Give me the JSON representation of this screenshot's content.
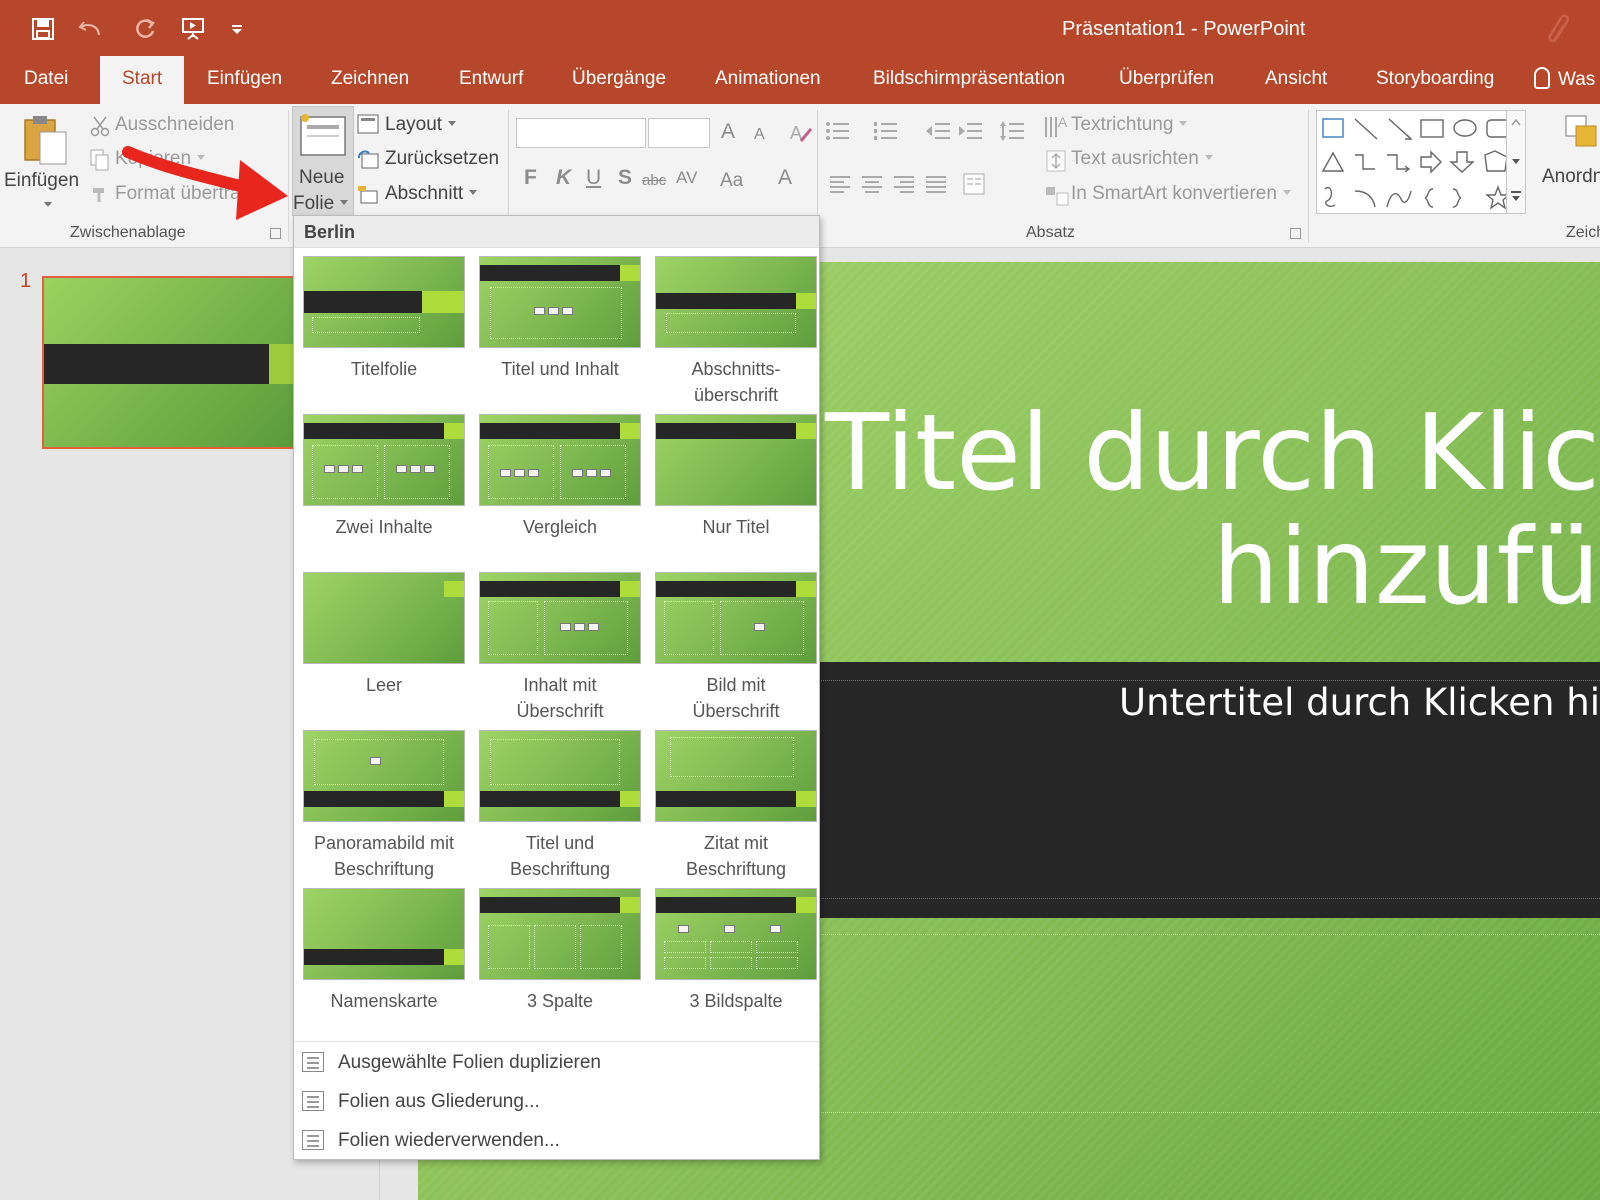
{
  "window": {
    "title": "Präsentation1 - PowerPoint",
    "accent_color": "#b7472a"
  },
  "quick_access": [
    "save-icon",
    "undo-icon",
    "redo-icon",
    "start-from-beginning-icon",
    "customize-icon"
  ],
  "tabs": [
    {
      "label": "Datei"
    },
    {
      "label": "Start"
    },
    {
      "label": "Einfügen"
    },
    {
      "label": "Zeichnen"
    },
    {
      "label": "Entwurf"
    },
    {
      "label": "Übergänge"
    },
    {
      "label": "Animationen"
    },
    {
      "label": "Bildschirmpräsentation"
    },
    {
      "label": "Überprüfen"
    },
    {
      "label": "Ansicht"
    },
    {
      "label": "Storyboarding"
    }
  ],
  "tell_me": "Was",
  "ribbon": {
    "clipboard": {
      "paste_label": "Einfügen",
      "cut_label": "Ausschneiden",
      "copy_label": "Kopieren",
      "format_painter_label": "Format übertragen",
      "group_label": "Zwischenablage"
    },
    "slides": {
      "new_slide_line1": "Neue",
      "new_slide_line2": "Folie",
      "layout_label": "Layout",
      "reset_label": "Zurücksetzen",
      "section_label": "Abschnitt"
    },
    "font": {
      "bold": "F",
      "italic": "K",
      "underline": "U",
      "shadow": "S",
      "strikethrough": "abc",
      "spacing": "AV",
      "case": "Aa",
      "grow": "A",
      "shrink": "A",
      "color": "A"
    },
    "paragraph": {
      "text_direction_label": "Textrichtung",
      "align_text_label": "Text ausrichten",
      "smartart_label": "In SmartArt konvertieren",
      "group_label": "Absatz"
    },
    "drawing": {
      "arrange_label": "Anordn",
      "group_label": "Zeich"
    }
  },
  "slide_panel": {
    "slide_number": "1"
  },
  "slide": {
    "title": "Titel durch Klic\nhinzufü",
    "subtitle": "Untertitel durch Klicken hi"
  },
  "layout_menu": {
    "theme_name": "Berlin",
    "layouts": [
      {
        "label": "Titelfolie"
      },
      {
        "label": "Titel und Inhalt"
      },
      {
        "label": "Abschnitts-\nüberschrift"
      },
      {
        "label": "Zwei Inhalte"
      },
      {
        "label": "Vergleich"
      },
      {
        "label": "Nur Titel"
      },
      {
        "label": "Leer"
      },
      {
        "label": "Inhalt mit\nÜberschrift"
      },
      {
        "label": "Bild mit\nÜberschrift"
      },
      {
        "label": "Panoramabild mit\nBeschriftung"
      },
      {
        "label": "Titel und\nBeschriftung"
      },
      {
        "label": "Zitat mit\nBeschriftung"
      },
      {
        "label": "Namenskarte"
      },
      {
        "label": "3 Spalte"
      },
      {
        "label": "3 Bildspalte"
      }
    ],
    "commands": [
      {
        "label": "Ausgewählte Folien duplizieren"
      },
      {
        "label": "Folien aus Gliederung..."
      },
      {
        "label": "Folien wiederverwenden..."
      }
    ]
  }
}
